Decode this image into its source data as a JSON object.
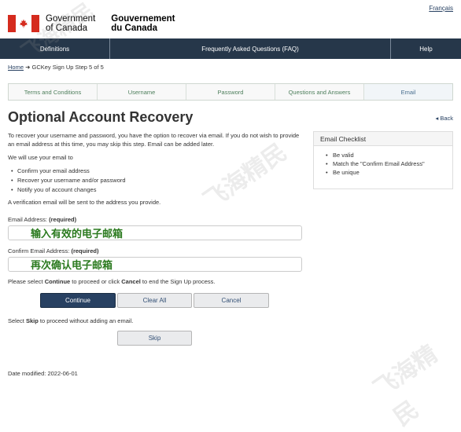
{
  "lang_link": "Français",
  "header": {
    "en_line1": "Government",
    "en_line2": "of Canada",
    "fr_line1": "Gouvernement",
    "fr_line2": "du Canada"
  },
  "menu": [
    "Definitions",
    "Frequently Asked Questions (FAQ)",
    "Help"
  ],
  "breadcrumb": {
    "home": "Home",
    "current": "GCKey Sign Up Step 5 of 5"
  },
  "steps": [
    "Terms and Conditions",
    "Username",
    "Password",
    "Questions and Answers",
    "Email"
  ],
  "page_title": "Optional Account Recovery",
  "back_label": "Back",
  "intro_text": "To recover your username and password, you have the option to recover via email. If you do not wish to provide an email address at this time, you may skip this step. Email can be added later.",
  "use_label": "We will use your email to",
  "use_items": [
    "Confirm your email address",
    "Recover your username and/or password",
    "Notify you of account changes"
  ],
  "verify_text": "A verification email will be sent to the address you provide.",
  "checklist": {
    "title": "Email Checklist",
    "items": [
      "Be valid",
      "Match the \"Confirm Email Address\"",
      "Be unique"
    ]
  },
  "email_field": {
    "label": "Email Address:",
    "required": "(required)",
    "value": "输入有效的电子邮箱"
  },
  "confirm_field": {
    "label": "Confirm Email Address:",
    "required": "(required)",
    "value": "再次确认电子邮箱"
  },
  "proceed_text": {
    "pre": "Please select ",
    "continue_word": "Continue",
    "mid": " to proceed or click ",
    "cancel_word": "Cancel",
    "post": " to end the Sign Up process."
  },
  "buttons": {
    "continue": "Continue",
    "clear": "Clear All",
    "cancel": "Cancel",
    "skip": "Skip"
  },
  "skip_text": {
    "pre": "Select ",
    "skip_word": "Skip",
    "post": " to proceed without adding an email."
  },
  "modified": "Date modified: 2022-06-01",
  "watermark": "飞海精民"
}
